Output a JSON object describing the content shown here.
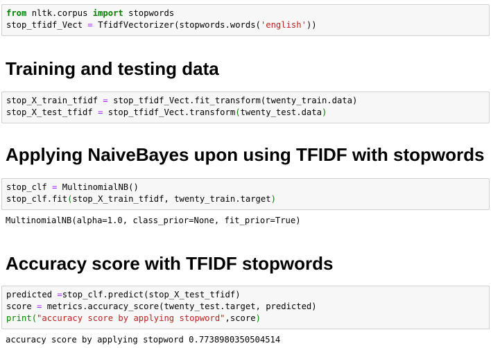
{
  "cells": {
    "import_cell": {
      "line1": {
        "kw1": "from",
        "mod": " nltk.corpus ",
        "kw2": "import",
        "name": " stopwords"
      },
      "line2": {
        "var": "stop_tfidf_Vect ",
        "eq": "=",
        "call": " TfidfVectorizer(stopwords.words(",
        "arg": "'english'",
        "close": "))"
      }
    },
    "heading_training": "Training and testing data",
    "transform_cell": {
      "line1": {
        "var": "stop_X_train_tfidf ",
        "eq": "=",
        "call": " stop_tfidf_Vect.fit_transform(twenty_train.data)"
      },
      "line2": {
        "var": "stop_X_test_tfidf ",
        "eq": "=",
        "call": " stop_tfidf_Vect.transform",
        "open": "(",
        "arg": "twenty_test.data",
        "close": ")"
      }
    },
    "heading_naivebayes": "Applying NaiveBayes upon using TFIDF with stopwords",
    "fit_cell": {
      "line1": {
        "var": "stop_clf ",
        "eq": "=",
        "call": " MultinomialNB()"
      },
      "line2": {
        "call": "stop_clf.fit",
        "open": "(",
        "arg": "stop_X_train_tfidf, twenty_train.target",
        "close": ")"
      }
    },
    "fit_output": "MultinomialNB(alpha=1.0, class_prior=None, fit_prior=True)",
    "heading_accuracy": "Accuracy score with TFIDF stopwords",
    "predict_cell": {
      "line1": {
        "var": "predicted ",
        "eq": "=",
        "call": "stop_clf.predict(stop_X_test_tfidf)"
      },
      "line2": {
        "var": "score ",
        "eq": "=",
        "call": " metrics.accuracy_score(twenty_test.target, predicted)"
      },
      "line3": {
        "fn": "print",
        "open": "(",
        "str": "\"accuracy score by applying stopword\"",
        "rest": ",score",
        "close": ")"
      }
    },
    "predict_output": "accuracy score by applying stopword 0.7738980350504514"
  },
  "colors": {
    "keyword": "#008000",
    "operator": "#aa22ff",
    "string": "#ba2121",
    "cell_background": "#f7f7f7",
    "cell_border": "#cfcfcf"
  }
}
